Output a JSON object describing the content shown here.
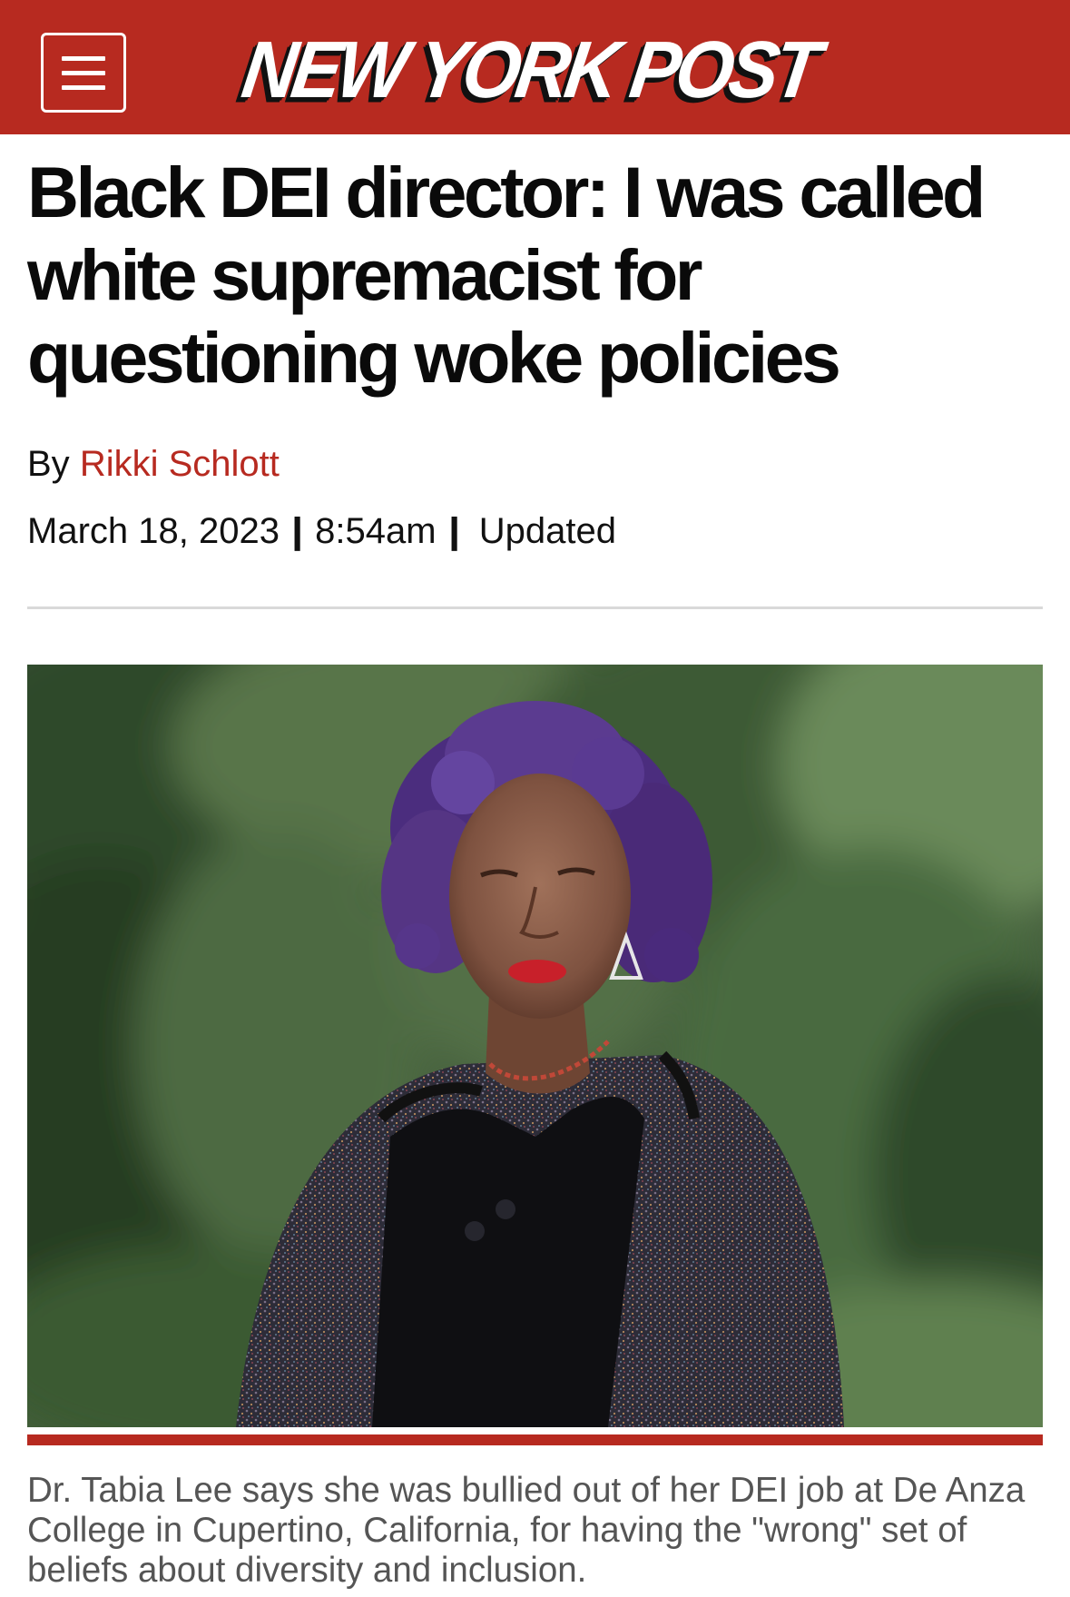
{
  "header": {
    "menu_icon": "hamburger-menu-icon",
    "logo_text": "NEW YORK POST",
    "brand_color": "#b72a20"
  },
  "article": {
    "headline": "Black DEI director: I was called white supremacist for questioning woke policies",
    "byline_prefix": "By",
    "author": "Rikki Schlott",
    "date": "March 18, 2023",
    "separator": "|",
    "time": "8:54am",
    "updated_label": "Updated",
    "photo_caption": "Dr. Tabia Lee says she was bullied out of her DEI job at De Anza College in Cupertino, California, for having the \"wrong\" set of beliefs about diversity and inclusion."
  }
}
